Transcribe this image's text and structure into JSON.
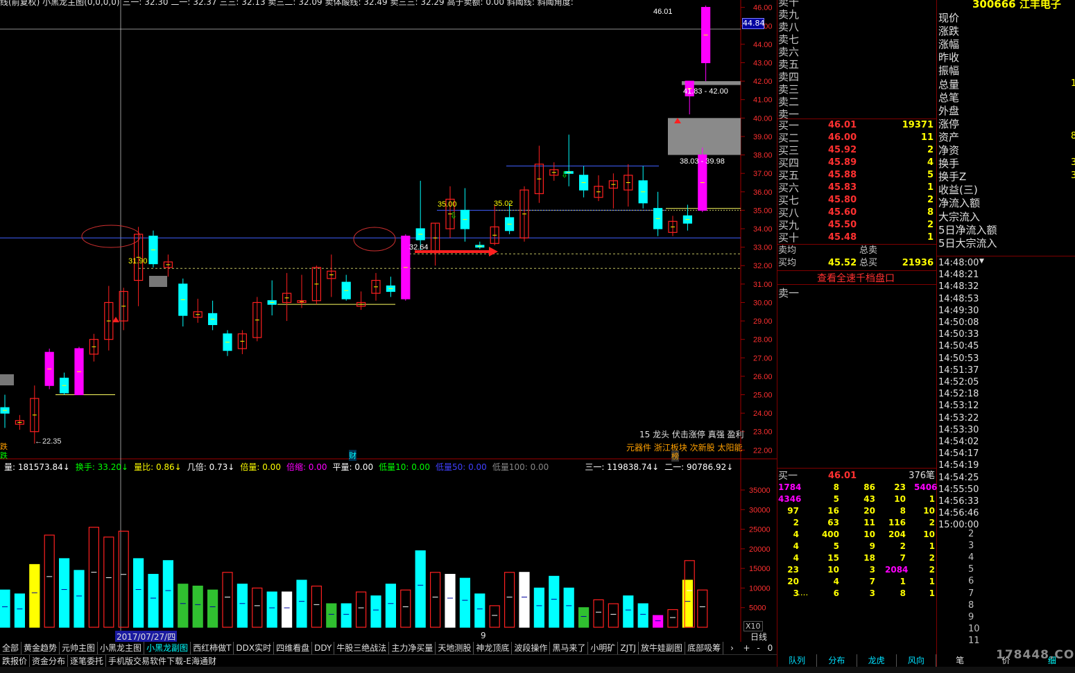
{
  "chart_data": {
    "type": "candlestick",
    "y_axis_ticks": [
      "46.00",
      "45.00",
      "44.00",
      "43.00",
      "42.00",
      "41.00",
      "40.00",
      "39.00",
      "38.00",
      "37.00",
      "36.00",
      "35.00",
      "34.00",
      "33.00",
      "32.00",
      "31.00",
      "30.00",
      "29.00",
      "28.00",
      "27.00",
      "26.00",
      "25.00",
      "24.00",
      "23.00",
      "22.00"
    ],
    "ylim": [
      21.6,
      46.4
    ],
    "candles": [
      {
        "o": 24.3,
        "h": 25.0,
        "l": 23.2,
        "c": 24.0,
        "col": "cyan"
      },
      {
        "o": 23.4,
        "h": 23.9,
        "l": 23.1,
        "c": 23.6,
        "col": "red"
      },
      {
        "o": 23.0,
        "h": 25.5,
        "l": 22.35,
        "c": 24.8,
        "col": "red"
      },
      {
        "o": 25.5,
        "h": 27.5,
        "l": 25.3,
        "c": 27.3,
        "col": "magenta"
      },
      {
        "o": 25.9,
        "h": 26.2,
        "l": 25.0,
        "c": 25.1,
        "col": "cyan"
      },
      {
        "o": 25.0,
        "h": 27.6,
        "l": 25.0,
        "c": 27.5,
        "col": "magenta"
      },
      {
        "o": 27.2,
        "h": 28.3,
        "l": 26.8,
        "c": 28.0,
        "col": "red"
      },
      {
        "o": 28.0,
        "h": 30.9,
        "l": 27.4,
        "c": 30.0,
        "col": "red"
      },
      {
        "o": 29.0,
        "h": 30.8,
        "l": 28.5,
        "c": 30.6,
        "col": "red"
      },
      {
        "o": 31.2,
        "h": 34.1,
        "l": 29.8,
        "c": 33.7,
        "col": "red"
      },
      {
        "o": 33.6,
        "h": 33.9,
        "l": 31.9,
        "c": 32.1,
        "col": "cyan"
      },
      {
        "o": 32.2,
        "h": 32.6,
        "l": 31.4,
        "c": 31.9,
        "col": "red"
      },
      {
        "o": 31.0,
        "h": 31.3,
        "l": 28.7,
        "c": 29.3,
        "col": "cyan"
      },
      {
        "o": 29.2,
        "h": 30.2,
        "l": 28.9,
        "c": 29.5,
        "col": "red"
      },
      {
        "o": 29.4,
        "h": 30.1,
        "l": 28.5,
        "c": 28.8,
        "col": "cyan"
      },
      {
        "o": 28.3,
        "h": 28.5,
        "l": 27.1,
        "c": 27.4,
        "col": "cyan"
      },
      {
        "o": 27.5,
        "h": 28.5,
        "l": 27.2,
        "c": 28.3,
        "col": "red"
      },
      {
        "o": 28.1,
        "h": 30.3,
        "l": 27.9,
        "c": 30.0,
        "col": "red"
      },
      {
        "o": 29.9,
        "h": 31.2,
        "l": 29.3,
        "c": 30.1,
        "col": "cyan"
      },
      {
        "o": 30.0,
        "h": 31.6,
        "l": 29.0,
        "c": 30.5,
        "col": "red"
      },
      {
        "o": 30.0,
        "h": 31.5,
        "l": 29.7,
        "c": 30.1,
        "col": "red"
      },
      {
        "o": 30.1,
        "h": 32.0,
        "l": 29.9,
        "c": 31.9,
        "col": "red"
      },
      {
        "o": 31.3,
        "h": 32.6,
        "l": 30.3,
        "c": 31.7,
        "col": "red"
      },
      {
        "o": 31.1,
        "h": 31.5,
        "l": 30.1,
        "c": 30.2,
        "col": "cyan"
      },
      {
        "o": 29.8,
        "h": 30.6,
        "l": 29.6,
        "c": 30.0,
        "col": "red"
      },
      {
        "o": 30.5,
        "h": 31.6,
        "l": 30.1,
        "c": 31.2,
        "col": "red"
      },
      {
        "o": 30.9,
        "h": 31.4,
        "l": 30.3,
        "c": 30.6,
        "col": "cyan"
      },
      {
        "o": 30.2,
        "h": 33.7,
        "l": 30.1,
        "c": 33.6,
        "col": "magenta"
      },
      {
        "o": 34.0,
        "h": 36.6,
        "l": 32.8,
        "c": 33.4,
        "col": "cyan"
      },
      {
        "o": 32.7,
        "h": 34.3,
        "l": 32.0,
        "c": 34.3,
        "col": "red"
      },
      {
        "o": 34.0,
        "h": 36.3,
        "l": 33.5,
        "c": 35.6,
        "col": "red"
      },
      {
        "o": 34.0,
        "h": 36.2,
        "l": 33.3,
        "c": 35.0,
        "col": "cyan"
      },
      {
        "o": 33.1,
        "h": 33.3,
        "l": 32.9,
        "c": 33.0,
        "col": "cyan"
      },
      {
        "o": 33.2,
        "h": 35.3,
        "l": 33.1,
        "c": 34.1,
        "col": "red"
      },
      {
        "o": 33.9,
        "h": 35.4,
        "l": 33.7,
        "c": 34.6,
        "col": "cyan"
      },
      {
        "o": 33.5,
        "h": 36.3,
        "l": 33.3,
        "c": 36.1,
        "col": "red"
      },
      {
        "o": 35.9,
        "h": 38.5,
        "l": 35.4,
        "c": 37.5,
        "col": "red"
      },
      {
        "o": 37.2,
        "h": 37.6,
        "l": 36.6,
        "c": 36.9,
        "col": "red"
      },
      {
        "o": 37.1,
        "h": 39.1,
        "l": 36.3,
        "c": 37.0,
        "col": "cyan"
      },
      {
        "o": 36.9,
        "h": 37.4,
        "l": 35.7,
        "c": 36.1,
        "col": "cyan"
      },
      {
        "o": 35.7,
        "h": 36.9,
        "l": 35.5,
        "c": 36.3,
        "col": "red"
      },
      {
        "o": 36.2,
        "h": 37.0,
        "l": 35.1,
        "c": 36.6,
        "col": "red"
      },
      {
        "o": 36.1,
        "h": 37.5,
        "l": 35.2,
        "c": 36.9,
        "col": "red"
      },
      {
        "o": 36.6,
        "h": 37.4,
        "l": 35.1,
        "c": 35.4,
        "col": "cyan"
      },
      {
        "o": 35.1,
        "h": 36.0,
        "l": 33.6,
        "c": 34.0,
        "col": "cyan"
      },
      {
        "o": 33.8,
        "h": 34.7,
        "l": 33.6,
        "c": 34.4,
        "col": "red"
      },
      {
        "o": 34.7,
        "h": 35.3,
        "l": 33.9,
        "c": 34.3,
        "col": "cyan"
      },
      {
        "o": 35.0,
        "h": 38.4,
        "l": 34.9,
        "c": 38.0,
        "col": "magenta"
      },
      {
        "o": 41.2,
        "h": 42.0,
        "l": 40.2,
        "c": 42.0,
        "col": "magenta"
      },
      {
        "o": 43.0,
        "h": 46.1,
        "l": 42.0,
        "c": 46.0,
        "col": "magenta"
      }
    ],
    "annotations": [
      "←22.35",
      "31.90",
      "35.00",
      "32.64",
      "35.02",
      "38.03 - 39.98",
      "41.83 - 42.00",
      "46.01"
    ],
    "current_price_tag": "44.84",
    "volume_ticks": [
      "35000",
      "30000",
      "25000",
      "20000",
      "15000",
      "10000",
      "5000"
    ],
    "volume_multiplier": "X10",
    "volumes": [
      {
        "v": 9500,
        "col": "cyan"
      },
      {
        "v": 8500,
        "col": "cyan"
      },
      {
        "v": 16000,
        "col": "yellow"
      },
      {
        "v": 23500,
        "col": "red"
      },
      {
        "v": 17500,
        "col": "cyan"
      },
      {
        "v": 14500,
        "col": "cyan"
      },
      {
        "v": 25500,
        "col": "red"
      },
      {
        "v": 23000,
        "col": "red"
      },
      {
        "v": 24500,
        "col": "red"
      },
      {
        "v": 17500,
        "col": "cyan"
      },
      {
        "v": 13500,
        "col": "cyan"
      },
      {
        "v": 17000,
        "col": "cyan"
      },
      {
        "v": 11000,
        "col": "green"
      },
      {
        "v": 10500,
        "col": "green"
      },
      {
        "v": 9500,
        "col": "green"
      },
      {
        "v": 14000,
        "col": "red"
      },
      {
        "v": 11000,
        "col": "cyan"
      },
      {
        "v": 10000,
        "col": "red"
      },
      {
        "v": 9000,
        "col": "cyan"
      },
      {
        "v": 9000,
        "col": "white"
      },
      {
        "v": 12000,
        "col": "cyan"
      },
      {
        "v": 10500,
        "col": "red"
      },
      {
        "v": 6000,
        "col": "green"
      },
      {
        "v": 6000,
        "col": "cyan"
      },
      {
        "v": 9000,
        "col": "red"
      },
      {
        "v": 8000,
        "col": "cyan"
      },
      {
        "v": 11000,
        "col": "cyan"
      },
      {
        "v": 9500,
        "col": "red"
      },
      {
        "v": 19500,
        "col": "cyan"
      },
      {
        "v": 14000,
        "col": "red"
      },
      {
        "v": 13500,
        "col": "white"
      },
      {
        "v": 12500,
        "col": "cyan"
      },
      {
        "v": 8500,
        "col": "cyan"
      },
      {
        "v": 5500,
        "col": "red"
      },
      {
        "v": 14000,
        "col": "red"
      },
      {
        "v": 14000,
        "col": "white"
      },
      {
        "v": 10000,
        "col": "cyan"
      },
      {
        "v": 13000,
        "col": "cyan"
      },
      {
        "v": 10000,
        "col": "cyan"
      },
      {
        "v": 5000,
        "col": "green"
      },
      {
        "v": 7000,
        "col": "red"
      },
      {
        "v": 6000,
        "col": "red"
      },
      {
        "v": 8000,
        "col": "cyan"
      },
      {
        "v": 6000,
        "col": "cyan"
      },
      {
        "v": 3000,
        "col": "magenta"
      },
      {
        "v": 4500,
        "col": "red"
      },
      {
        "v": 12000,
        "col": "yellow"
      },
      {
        "v": 9500,
        "col": "red"
      },
      {
        "v": 17000,
        "col": "red"
      }
    ]
  },
  "header": {
    "title_row": "线(前复权)  小黑龙主图(0,0,0,0)  三一: 32.30   二一: 32.37   三三: 32.13   卖三二: 32.09   卖体酸线: 32.49   卖三三: 32.29   高于卖额: 0.00  斜阈线: 斜阈角度:",
    "stock_code": "300666  江丰电子",
    "indicator_row": [
      {
        "t": "量: 181573.84↓",
        "c": "#ffffff"
      },
      {
        "t": "换手: 33.20↓",
        "c": "#00ff00"
      },
      {
        "t": "量比: 0.86↓",
        "c": "#ffff00"
      },
      {
        "t": "几倍: 0.73↓",
        "c": "#ffffff"
      },
      {
        "t": "倍量: 0.00",
        "c": "#ffff00"
      },
      {
        "t": "倍缩: 0.00",
        "c": "#ff00ff"
      },
      {
        "t": "平量: 0.00",
        "c": "#ffffff"
      },
      {
        "t": "低量10: 0.00",
        "c": "#00ff00"
      },
      {
        "t": "低量50: 0.00",
        "c": "#4040ff"
      },
      {
        "t": "低量100: 0.00",
        "c": "#888888"
      },
      {
        "t": "三一: 119838.74↓",
        "c": "#ffffff"
      },
      {
        "t": "二一: 90786.92↓",
        "c": "#ffffff"
      }
    ],
    "date_marker": "2017/07/27/四",
    "date_marker_2": "9",
    "period": "日线",
    "tags_text": "15 龙头 伏击涨停 真强 盈利",
    "sector_text": "元器件 浙江板块 次新股 太阳能",
    "sector_badge": "榜",
    "left_marks": [
      "跌",
      "跌",
      "财"
    ]
  },
  "order_book": {
    "asks": [
      "卖十",
      "卖九",
      "卖八",
      "卖七",
      "卖六",
      "卖五",
      "卖四",
      "卖三",
      "卖二",
      "卖一"
    ],
    "bids": [
      {
        "name": "买一",
        "price": "46.01",
        "vol": "19371"
      },
      {
        "name": "买二",
        "price": "46.00",
        "vol": "11"
      },
      {
        "name": "买三",
        "price": "45.92",
        "vol": "2"
      },
      {
        "name": "买四",
        "price": "45.89",
        "vol": "4"
      },
      {
        "name": "买五",
        "price": "45.88",
        "vol": "5"
      },
      {
        "name": "买六",
        "price": "45.83",
        "vol": "1"
      },
      {
        "name": "买七",
        "price": "45.80",
        "vol": "2"
      },
      {
        "name": "买八",
        "price": "45.60",
        "vol": "8"
      },
      {
        "name": "买九",
        "price": "45.50",
        "vol": "2"
      },
      {
        "name": "买十",
        "price": "45.48",
        "vol": "1"
      }
    ],
    "avg_sell_label": "卖均",
    "total_sell_label": "总卖",
    "avg_buy_label": "买均",
    "avg_buy": "45.52",
    "total_buy_label": "总买",
    "total_buy": "21936",
    "full_depth_link": "查看全速千档盘口",
    "sell1_label": "卖一",
    "queue_header": {
      "label": "买一",
      "price": "46.01",
      "count": "376笔"
    },
    "queue": [
      [
        "1784",
        "8",
        "86",
        "23",
        "5406"
      ],
      [
        "4346",
        "5",
        "43",
        "10",
        "1"
      ],
      [
        "97",
        "16",
        "20",
        "8",
        "10"
      ],
      [
        "2",
        "63",
        "11",
        "116",
        "2"
      ],
      [
        "4",
        "400",
        "10",
        "204",
        "10"
      ],
      [
        "4",
        "5",
        "9",
        "2",
        "1"
      ],
      [
        "4",
        "15",
        "18",
        "7",
        "2"
      ],
      [
        "23",
        "10",
        "3",
        "2084",
        "2"
      ],
      [
        "20",
        "4",
        "7",
        "1",
        "1"
      ],
      [
        "3",
        "6",
        "3",
        "8",
        "1"
      ]
    ],
    "queue_more": "....",
    "bottom_tabs": [
      "队列",
      "分布",
      "龙虎",
      "风向"
    ]
  },
  "stats": {
    "items": [
      "现价",
      "涨跌",
      "涨幅",
      "昨收",
      "振幅",
      "总量",
      "总笔",
      "外盘",
      "涨停",
      "资产",
      "净资",
      "换手",
      "换手Z",
      "收益(三)",
      "净流入额",
      "大宗流入",
      "5日净流入额",
      "5日大宗流入"
    ],
    "partial_values": {
      "总量": "1",
      "资产": "8",
      "换手": "3",
      "换手Z": "3"
    }
  },
  "ticks": {
    "times": [
      "14:48:00",
      "14:48:21",
      "14:48:32",
      "14:48:53",
      "14:49:30",
      "14:50:08",
      "14:50:33",
      "14:50:45",
      "14:50:53",
      "14:51:37",
      "14:52:05",
      "14:52:18",
      "14:53:12",
      "14:53:22",
      "14:53:30",
      "14:54:02",
      "14:54:17",
      "14:54:19",
      "14:54:25",
      "14:55:50",
      "14:56:33",
      "14:56:46",
      "15:00:00"
    ],
    "numbers": [
      "2",
      "3",
      "4",
      "5",
      "6",
      "7",
      "8",
      "9",
      "10",
      "11"
    ],
    "tab_labels": [
      "笔",
      "价",
      "细"
    ]
  },
  "tabs": [
    "全部",
    "黄金趋势",
    "元帅主图",
    "小黑龙主图",
    "小黑龙副图",
    "西红柿做T",
    "DDX实时",
    "四维看盘",
    "DDY",
    "牛股三绝战法",
    "主力净买量",
    "天地测股",
    "神龙顶底",
    "波段操作",
    "黑马来了",
    "小明矿",
    "ZJTJ",
    "放牛娃副图",
    "底部吸筹"
  ],
  "active_tab": "小黑龙副图",
  "tab_controls": [
    "›",
    "+",
    "-",
    "0"
  ],
  "bottom_bar": [
    "跌报价",
    "资金分布",
    "逐笔委托",
    "手机版交易软件下载-E海通财"
  ],
  "watermark": "178448.COM"
}
